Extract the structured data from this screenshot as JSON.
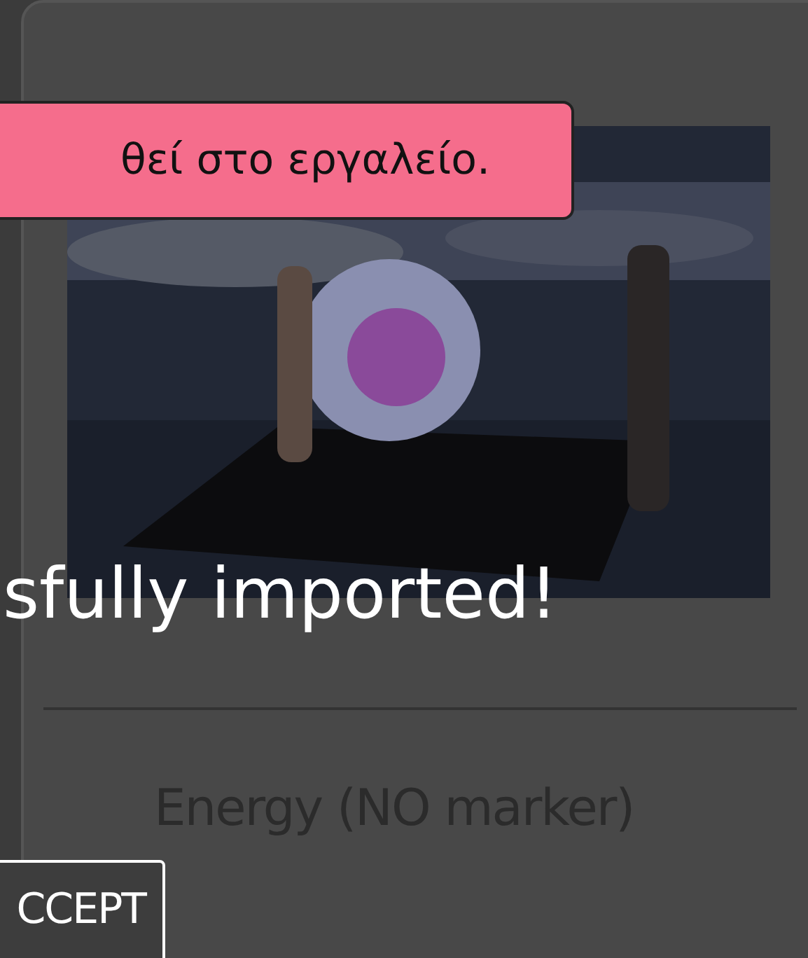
{
  "tooltip": {
    "text": "θεί στο εργαλείο."
  },
  "heading": "sfully imported!",
  "item": {
    "label": "Energy (NO marker)"
  },
  "button": {
    "label": "CCEPT"
  }
}
